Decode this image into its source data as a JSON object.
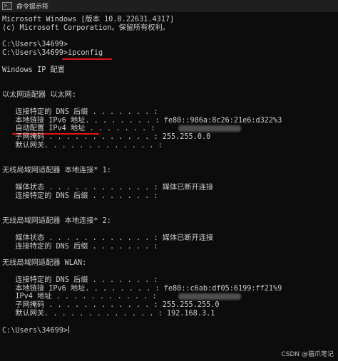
{
  "window": {
    "title": "命令提示符",
    "icon": "cmd-icon"
  },
  "header": {
    "version": "Microsoft Windows [版本 10.0.22631.4317]",
    "copyright": "(c) Microsoft Corporation。保留所有权利。"
  },
  "prompt1": "C:\\Users\\34699>",
  "prompt2_path": "C:\\Users\\34699>",
  "command": "ipconfig",
  "ip_title": "Windows IP 配置",
  "eth": {
    "heading": "以太网适配器 以太网:",
    "dns_label": "   连接特定的 DNS 后缀 . . . . . . . :",
    "ipv6_label": "   本地链接 IPv6 地址. . . . . . . . :",
    "ipv6_value": " fe80::986a:8c26:21e6:d322%3",
    "ipv4_label": "   自动配置 IPv4 地址 . . . . . . . :",
    "mask_label": "   子网掩码 . . . . . . . . . . . . :",
    "mask_value": " 255.255.0.0",
    "gw_label": "   默认网关. . . . . . . . . . . . . :"
  },
  "wlan1": {
    "heading": "无线局域网适配器 本地连接* 1:",
    "state_label": "   媒体状态 . . . . . . . . . . . . :",
    "state_value": " 媒体已断开连接",
    "dns_label": "   连接特定的 DNS 后缀 . . . . . . . :"
  },
  "wlan2": {
    "heading": "无线局域网适配器 本地连接* 2:",
    "state_label": "   媒体状态 . . . . . . . . . . . . :",
    "state_value": " 媒体已断开连接",
    "dns_label": "   连接特定的 DNS 后缀 . . . . . . . :"
  },
  "wlan": {
    "heading": "无线局域网适配器 WLAN:",
    "dns_label": "   连接特定的 DNS 后缀 . . . . . . . :",
    "ipv6_label": "   本地链接 IPv6 地址. . . . . . . . :",
    "ipv6_value": " fe80::c6ab:df05:6199:ff21%9",
    "ipv4_label": "   IPv4 地址 . . . . . . . . . . . :",
    "mask_label": "   子网掩码 . . . . . . . . . . . . :",
    "mask_value": " 255.255.255.0",
    "gw_label": "   默认网关. . . . . . . . . . . . . :",
    "gw_value": " 192.168.3.1"
  },
  "watermark": "CSDN @猫爪笔记",
  "colors": {
    "background": "#0c0c0c",
    "text": "#cccccc",
    "annotation": "#e01414"
  }
}
